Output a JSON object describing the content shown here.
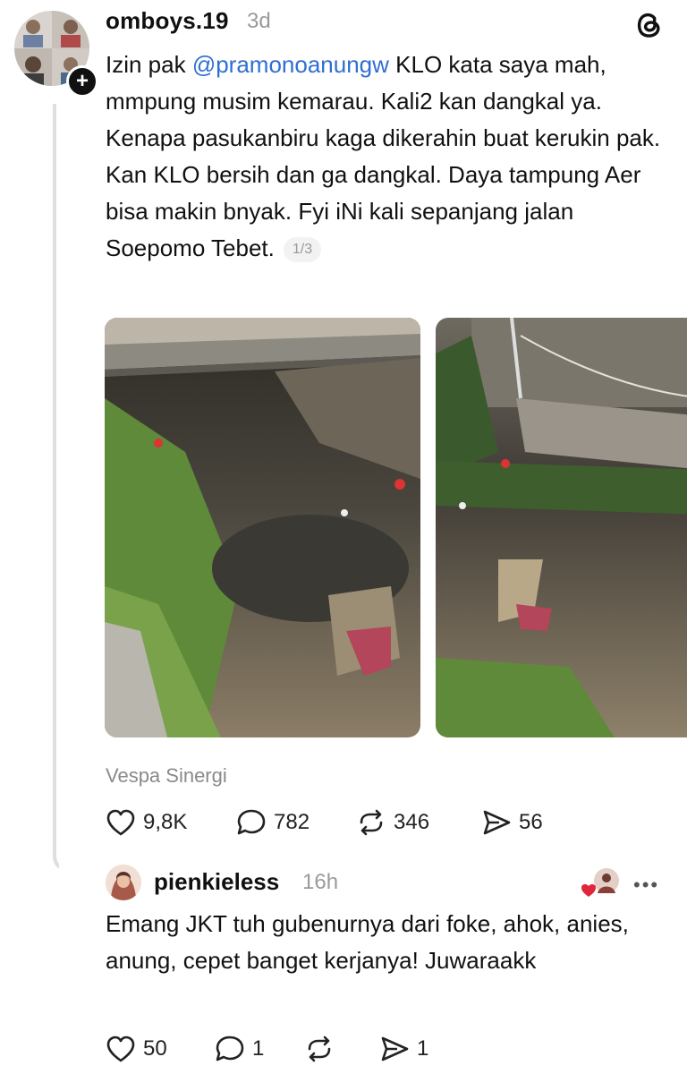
{
  "post": {
    "username": "omboys.19",
    "time": "3d",
    "text_before": "Izin pak ",
    "mention": "@pramonoanungw",
    "text_after": " KLO kata saya mah, mmpung musim kemarau. Kali2 kan dangkal ya. Kenapa pasukanbiru kaga dikerahin buat kerukin pak. Kan KLO bersih dan ga dangkal. Daya tampung Aer bisa makin bnyak. Fyi iNi kali sepanjang jalan Soepomo Tebet.",
    "page_indicator": "1/3",
    "photo_credit": "Vespa Sinergi",
    "likes": "9,8K",
    "replies": "782",
    "reposts": "346",
    "shares": "56"
  },
  "reply": {
    "username": "pienkieless",
    "time": "16h",
    "text": "Emang JKT tuh gubenurnya dari foke, ahok, anies, anung, cepet banget kerjanya! Juwaraakk",
    "likes": "50",
    "replies": "1",
    "shares": "1"
  },
  "icons": {
    "follow": "plus-icon",
    "app": "threads-logo",
    "like": "heart-icon",
    "reply": "comment-icon",
    "repost": "repost-icon",
    "share": "send-icon",
    "more": "more-icon"
  },
  "colors": {
    "mention": "#2f6ed3",
    "liked_heart": "#e0263b"
  }
}
